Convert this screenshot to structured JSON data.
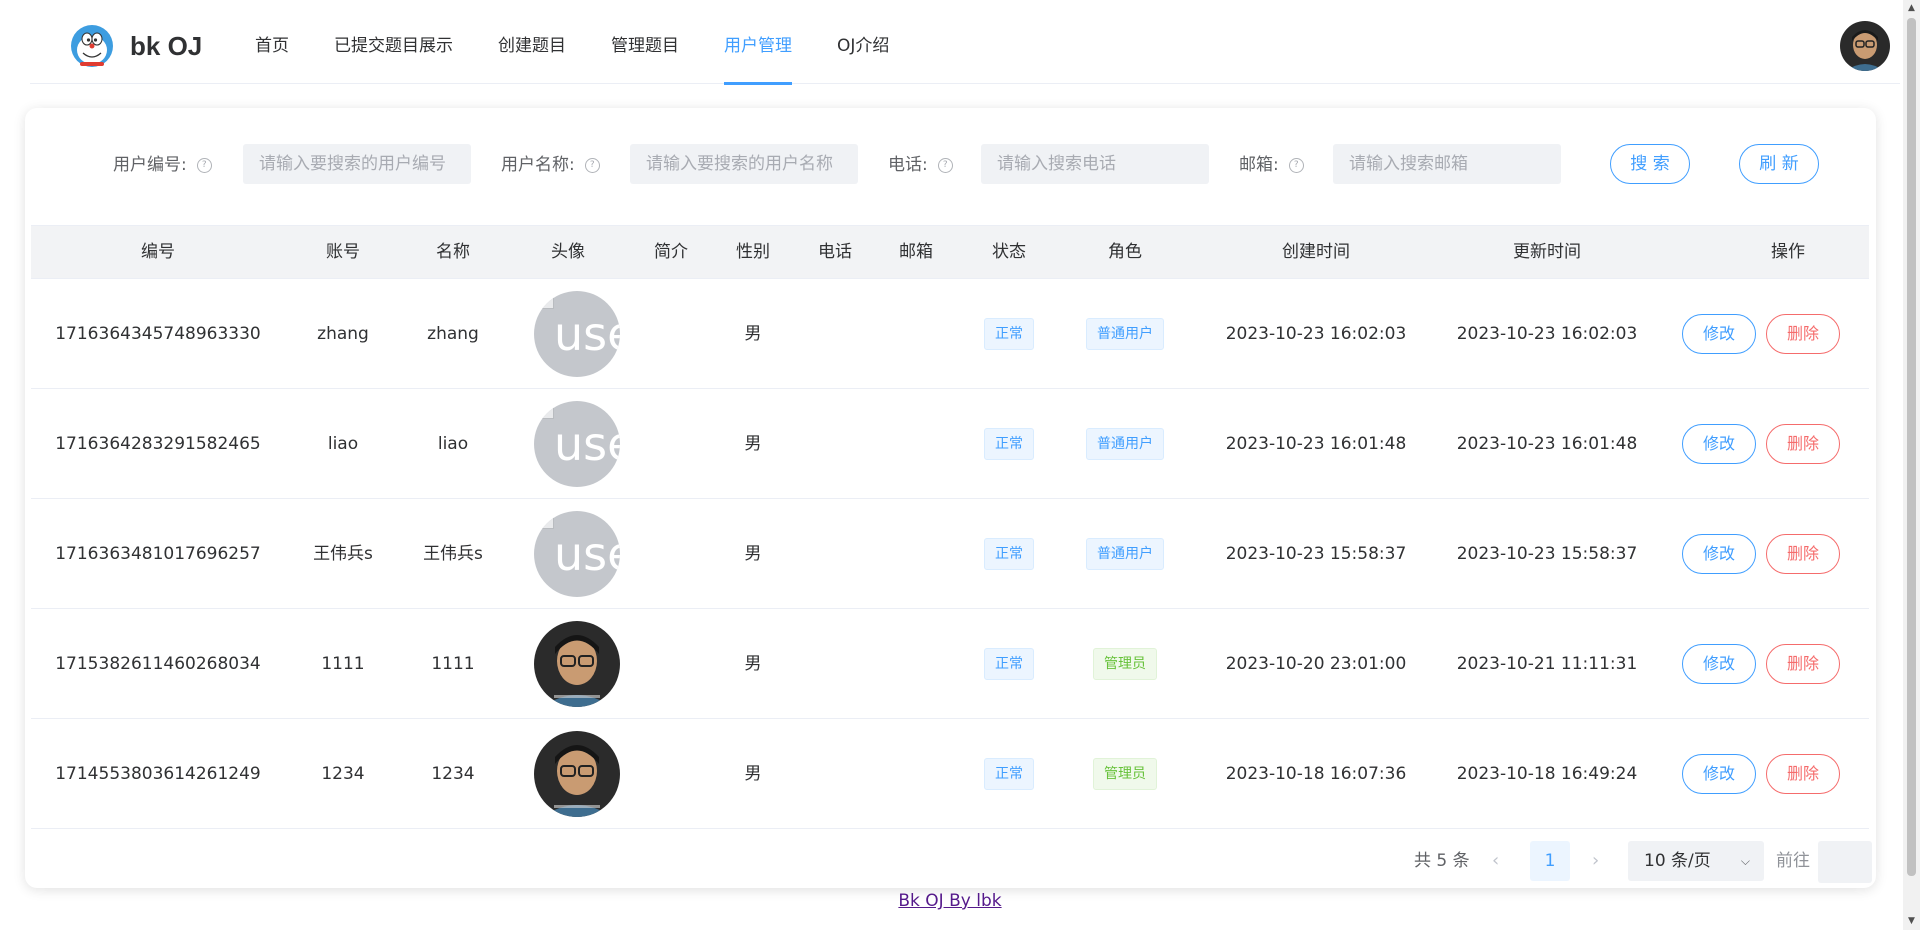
{
  "header": {
    "logo_title": "bk OJ",
    "nav": [
      "首页",
      "已提交题目展示",
      "创建题目",
      "管理题目",
      "用户管理",
      "OJ介绍"
    ],
    "active_nav": "用户管理"
  },
  "search": {
    "fields": [
      {
        "label": "用户编号:",
        "placeholder": "请输入要搜索的用户编号"
      },
      {
        "label": "用户名称:",
        "placeholder": "请输入要搜索的用户名称"
      },
      {
        "label": "电话:",
        "placeholder": "请输入搜索电话"
      },
      {
        "label": "邮箱:",
        "placeholder": "请输入搜索邮箱"
      }
    ],
    "search_button": "搜 索",
    "refresh_button": "刷 新"
  },
  "table": {
    "columns": [
      "编号",
      "账号",
      "名称",
      "头像",
      "简介",
      "性别",
      "电话",
      "邮箱",
      "状态",
      "角色",
      "创建时间",
      "更新时间",
      "操作"
    ],
    "rows": [
      {
        "id": "1716364345748963330",
        "account": "zhang",
        "name": "zhang",
        "avatar_text": "use",
        "avatar_type": "broken",
        "intro": "",
        "gender": "男",
        "phone": "",
        "email": "",
        "status": "正常",
        "role": "普通用户",
        "role_type": "user",
        "created": "2023-10-23 16:02:03",
        "updated": "2023-10-23 16:02:03"
      },
      {
        "id": "1716364283291582465",
        "account": "liao",
        "name": "liao",
        "avatar_text": "use",
        "avatar_type": "broken",
        "intro": "",
        "gender": "男",
        "phone": "",
        "email": "",
        "status": "正常",
        "role": "普通用户",
        "role_type": "user",
        "created": "2023-10-23 16:01:48",
        "updated": "2023-10-23 16:01:48"
      },
      {
        "id": "1716363481017696257",
        "account": "王伟兵s",
        "name": "王伟兵s",
        "avatar_text": "use",
        "avatar_type": "broken",
        "intro": "",
        "gender": "男",
        "phone": "",
        "email": "",
        "status": "正常",
        "role": "普通用户",
        "role_type": "user",
        "created": "2023-10-23 15:58:37",
        "updated": "2023-10-23 15:58:37"
      },
      {
        "id": "1715382611460268034",
        "account": "1111",
        "name": "1111",
        "avatar_text": "",
        "avatar_type": "photo",
        "intro": "",
        "gender": "男",
        "phone": "",
        "email": "",
        "status": "正常",
        "role": "管理员",
        "role_type": "admin",
        "created": "2023-10-20 23:01:00",
        "updated": "2023-10-21 11:11:31"
      },
      {
        "id": "1714553803614261249",
        "account": "1234",
        "name": "1234",
        "avatar_text": "",
        "avatar_type": "photo",
        "intro": "",
        "gender": "男",
        "phone": "",
        "email": "",
        "status": "正常",
        "role": "管理员",
        "role_type": "admin",
        "created": "2023-10-18 16:07:36",
        "updated": "2023-10-18 16:49:24"
      }
    ],
    "edit_label": "修改",
    "delete_label": "删除"
  },
  "pagination": {
    "total": "共 5 条",
    "current_page": "1",
    "page_size": "10 条/页",
    "goto_label": "前往"
  },
  "footer": {
    "link_text": "Bk OJ By lbk"
  },
  "colors": {
    "primary": "#409eff",
    "danger": "#f56c6c",
    "success": "#67c23a"
  }
}
